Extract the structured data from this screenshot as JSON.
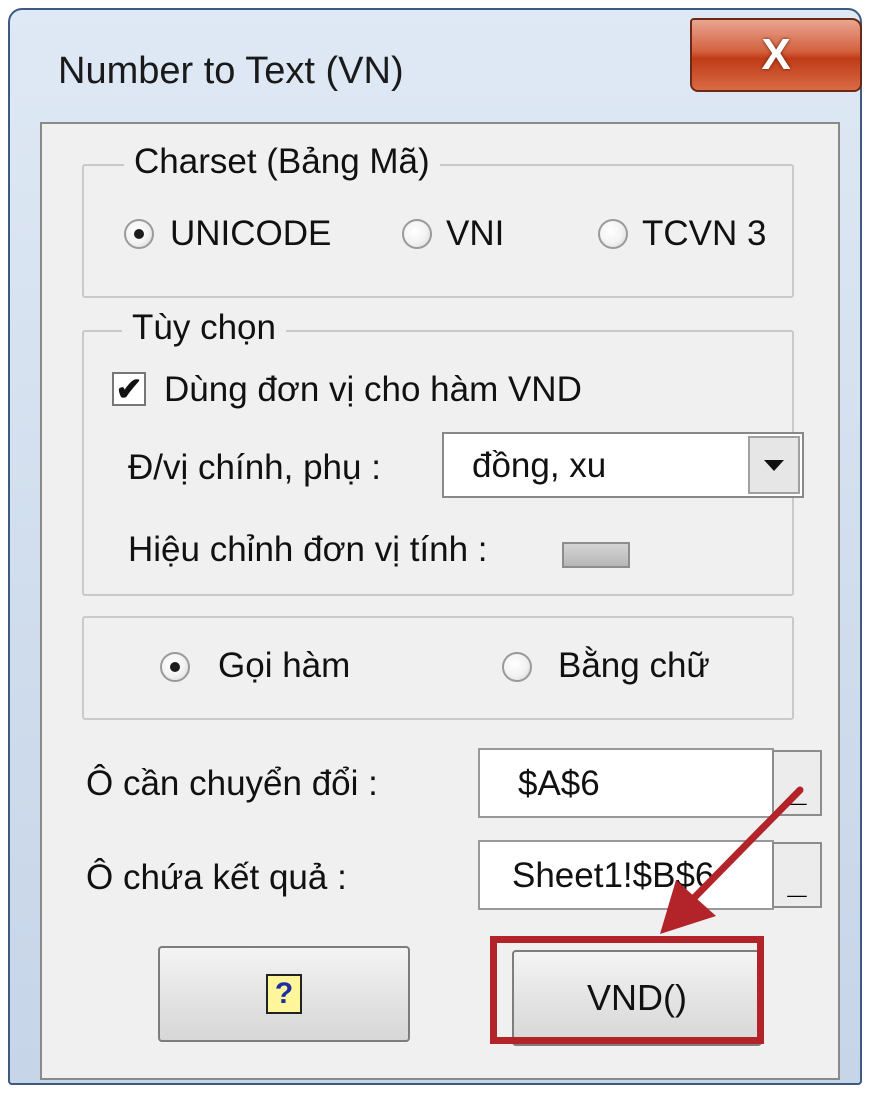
{
  "window": {
    "title": "Number to Text (VN)",
    "close_glyph": "X"
  },
  "charset": {
    "legend": "Charset (Bảng Mã)",
    "options": [
      {
        "label": "UNICODE",
        "selected": true
      },
      {
        "label": "VNI",
        "selected": false
      },
      {
        "label": "TCVN 3",
        "selected": false
      }
    ]
  },
  "options": {
    "legend": "Tùy chọn",
    "use_unit_label": "Dùng đơn vị cho hàm VND",
    "use_unit_checked": true,
    "unit_label": "Đ/vị chính, phụ :",
    "unit_value": "đồng, xu",
    "adjust_label": "Hiệu chỉnh đơn vị tính :"
  },
  "mode": {
    "options": [
      {
        "label": "Gọi hàm",
        "selected": true
      },
      {
        "label": "Bằng chữ",
        "selected": false
      }
    ]
  },
  "source": {
    "label": "Ô cần chuyển đổi :",
    "value": "$A$6",
    "pick_label": "_"
  },
  "target": {
    "label": "Ô chứa kết quả :",
    "value": "Sheet1!$B$6",
    "pick_label": "_"
  },
  "buttons": {
    "help_glyph": "?",
    "vnd_label": "VND()"
  },
  "colors": {
    "annotation": "#b3232a"
  }
}
